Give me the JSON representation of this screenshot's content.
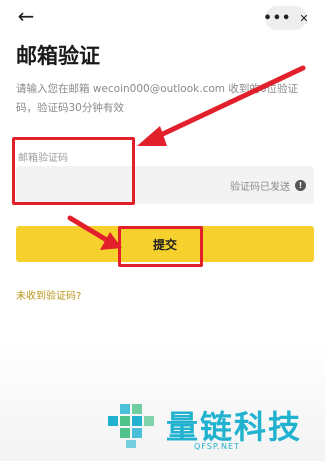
{
  "header": {
    "back_icon": "arrow-left-icon",
    "more_icon": "more-icon",
    "close_icon": "close-icon",
    "back_glyph": "←",
    "more_glyph": "•••",
    "close_glyph": "✕"
  },
  "page": {
    "title": "邮箱验证",
    "description": "请输入您在邮箱 wecoin000@outlook.com 收到的6位验证码，验证码30分钟有效"
  },
  "form": {
    "field_label": "邮箱验证码",
    "code_value": "",
    "sent_status": "验证码已发送",
    "info_glyph": "!",
    "submit_label": "提交",
    "resend_link": "未收到验证码?"
  },
  "watermark": {
    "name": "量链科技",
    "domain": "QFSP.NET"
  },
  "colors": {
    "accent_yellow": "#f6d12e",
    "annotation_red": "#e2202c",
    "link_gold": "#b8961a",
    "watermark_cyan": "#21b2cf"
  }
}
